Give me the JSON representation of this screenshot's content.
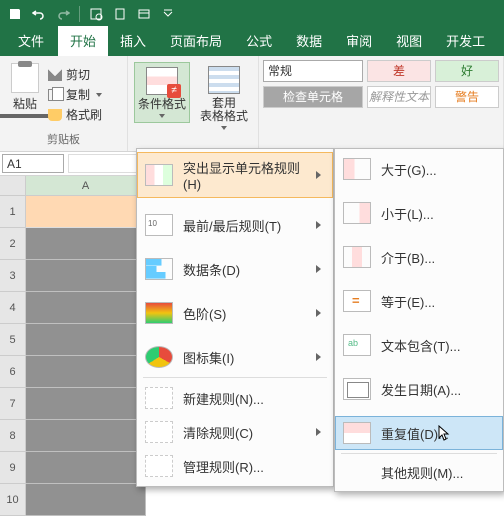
{
  "qat": {
    "save": "",
    "undo": "",
    "redo": ""
  },
  "tabs": {
    "file": "文件",
    "home": "开始",
    "insert": "插入",
    "pagelayout": "页面布局",
    "formulas": "公式",
    "data": "数据",
    "review": "审阅",
    "view": "视图",
    "developer": "开发工"
  },
  "ribbon": {
    "clipboard": {
      "paste": "粘贴",
      "cut": "剪切",
      "copy": "复制",
      "painter": "格式刷",
      "group_label": "剪贴板"
    },
    "cond": {
      "condfmt": "条件格式",
      "tablefmt": "套用\n表格格式"
    },
    "styles": {
      "numberfmt": "常规",
      "bad": "差",
      "good": "好",
      "check": "检查单元格",
      "note": "解释性文本",
      "warn": "警告"
    }
  },
  "namebox": "A1",
  "rows": [
    "1",
    "2",
    "3",
    "4",
    "5",
    "6",
    "7",
    "8",
    "9",
    "10"
  ],
  "cols": [
    "A"
  ],
  "menu1": {
    "highlight": "突出显示单元格规则(H)",
    "toprules": "最前/最后规则(T)",
    "databars": "数据条(D)",
    "colorscales": "色阶(S)",
    "iconsets": "图标集(I)",
    "newrule": "新建规则(N)...",
    "clearrules": "清除规则(C)",
    "managerules": "管理规则(R)..."
  },
  "menu2": {
    "gt": "大于(G)...",
    "lt": "小于(L)...",
    "bt": "介于(B)...",
    "eq": "等于(E)...",
    "txt": "文本包含(T)...",
    "date": "发生日期(A)...",
    "dup": "重复值(D)...",
    "other": "其他规则(M)..."
  }
}
